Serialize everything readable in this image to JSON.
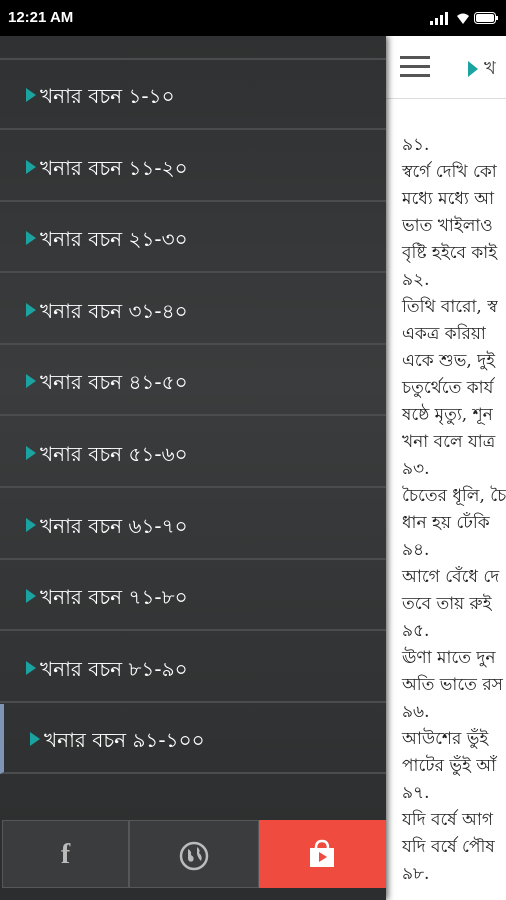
{
  "status_bar": {
    "time": "12:21 AM"
  },
  "content": {
    "title_partial": "খ",
    "lines": [
      "৯১.",
      "স্বর্গে দেখি কো",
      "মধ্যে মধ্যে আ",
      "ভাত খাইলাও",
      "বৃষ্টি হইবে কাই",
      "৯২.",
      "তিথি বারো, স্ব",
      "একত্র করিয়া",
      "একে শুভ, দুই",
      "চতুর্থেতে কার্য",
      "ষষ্ঠে মৃত্যু, শূন",
      "খনা বলে যাত্র",
      "৯৩.",
      "চৈতের ধূলি, চৈ",
      "ধান হয় ঢেঁকি",
      "৯৪.",
      "আগে বেঁধে দে",
      "তবে তায় রুই",
      "৯৫.",
      "ঊণা মাতে দুন",
      "অতি ভাতে রস",
      "৯৬.",
      "আউশের ভুঁই",
      "পাটের ভুঁই আঁ",
      "৯৭.",
      "যদি বর্ষে আগ",
      "যদি বর্ষে পৌষ",
      "৯৮."
    ]
  },
  "drawer": {
    "items": [
      {
        "label": "খনার বচন ১-১০"
      },
      {
        "label": "খনার বচন ১১-২০"
      },
      {
        "label": "খনার বচন ২১-৩০"
      },
      {
        "label": "খনার বচন ৩১-৪০"
      },
      {
        "label": "খনার বচন ৪১-৫০"
      },
      {
        "label": "খনার বচন ৫১-৬০"
      },
      {
        "label": "খনার বচন ৬১-৭০"
      },
      {
        "label": "খনার বচন ৭১-৮০"
      },
      {
        "label": "খনার বচন ৮১-৯০"
      },
      {
        "label": "খনার বচন ৯১-১০০"
      }
    ],
    "active_index": 9
  },
  "bottom_bar": {
    "facebook_icon": "facebook-icon",
    "globe_icon": "globe-icon",
    "store_icon": "shopping-bag-icon",
    "accent_color": "#ef4b3f"
  }
}
